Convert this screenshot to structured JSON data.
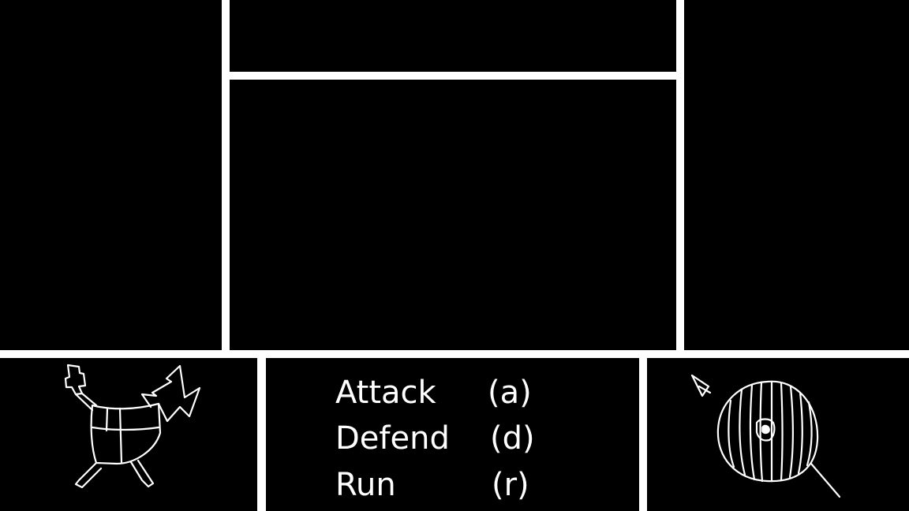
{
  "menu": {
    "items": [
      {
        "label": "Attack",
        "key": "(a)"
      },
      {
        "label": "Defend",
        "key": "(d)"
      },
      {
        "label": "Run",
        "key": "(r)"
      }
    ]
  },
  "sprites": {
    "player": "armored-knight-with-lightning-sprite",
    "enemy": "round-striped-shield-with-arrow-sprite"
  },
  "colors": {
    "background": "#000000",
    "lines": "#ffffff",
    "text": "#ffffff"
  }
}
